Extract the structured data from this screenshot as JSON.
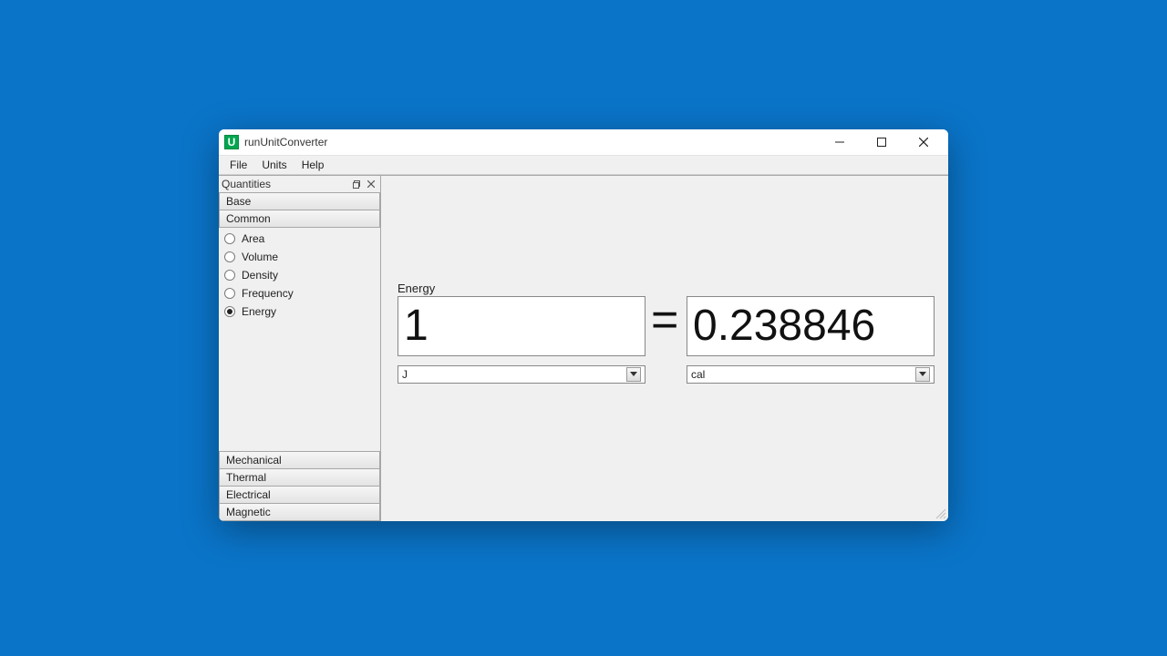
{
  "window": {
    "title": "runUnitConverter",
    "icon_letter": "U"
  },
  "menu": {
    "file": "File",
    "units": "Units",
    "help": "Help"
  },
  "sidebar": {
    "title": "Quantities",
    "top_categories": [
      "Base",
      "Common"
    ],
    "items": [
      {
        "label": "Area",
        "checked": false
      },
      {
        "label": "Volume",
        "checked": false
      },
      {
        "label": "Density",
        "checked": false
      },
      {
        "label": "Frequency",
        "checked": false
      },
      {
        "label": "Energy",
        "checked": true
      }
    ],
    "bottom_categories": [
      "Mechanical",
      "Thermal",
      "Electrical",
      "Magnetic"
    ]
  },
  "main": {
    "heading": "Energy",
    "left_value": "1",
    "right_value": "0.238846",
    "equals": "=",
    "left_unit": "J",
    "right_unit": "cal"
  }
}
